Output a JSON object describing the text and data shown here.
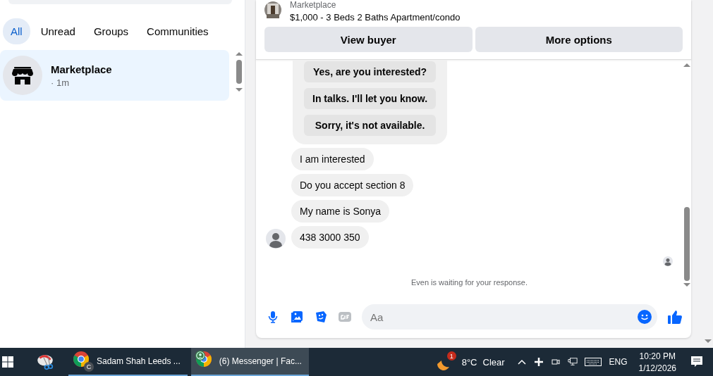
{
  "sidebar": {
    "filters": [
      {
        "label": "All",
        "selected": true
      },
      {
        "label": "Unread",
        "selected": false
      },
      {
        "label": "Groups",
        "selected": false
      },
      {
        "label": "Communities",
        "selected": false
      }
    ],
    "conversations": [
      {
        "name": "Marketplace",
        "time": "· 1m",
        "selected": true
      }
    ]
  },
  "chat": {
    "header": {
      "source": "Marketplace",
      "listing": "$1,000 - 3 Beds 2 Baths Apartment/condo"
    },
    "actions": [
      "View buyer",
      "More options"
    ],
    "quick_replies": [
      "Yes, are you interested?",
      "In talks. I'll let you know.",
      "Sorry, it's not available."
    ],
    "messages": [
      {
        "text": "I am interested",
        "show_avatar": false
      },
      {
        "text": "Do you accept section 8",
        "show_avatar": false
      },
      {
        "text": "My name is Sonya",
        "show_avatar": false
      },
      {
        "text": "438 3000 350",
        "show_avatar": true
      }
    ],
    "status": "Even is waiting for your response.",
    "composer": {
      "placeholder": "Aa"
    }
  },
  "taskbar": {
    "apps": [
      {
        "label": "Sadam Shah Leeds ...",
        "badge": "C",
        "selected": false
      },
      {
        "label": "(6) Messenger | Fac...",
        "selected": true
      }
    ],
    "weather": {
      "badge": "1",
      "temperature": "8°C",
      "condition": "Clear"
    },
    "language": "ENG",
    "time": "10:20 PM",
    "date": "1/12/2026"
  }
}
